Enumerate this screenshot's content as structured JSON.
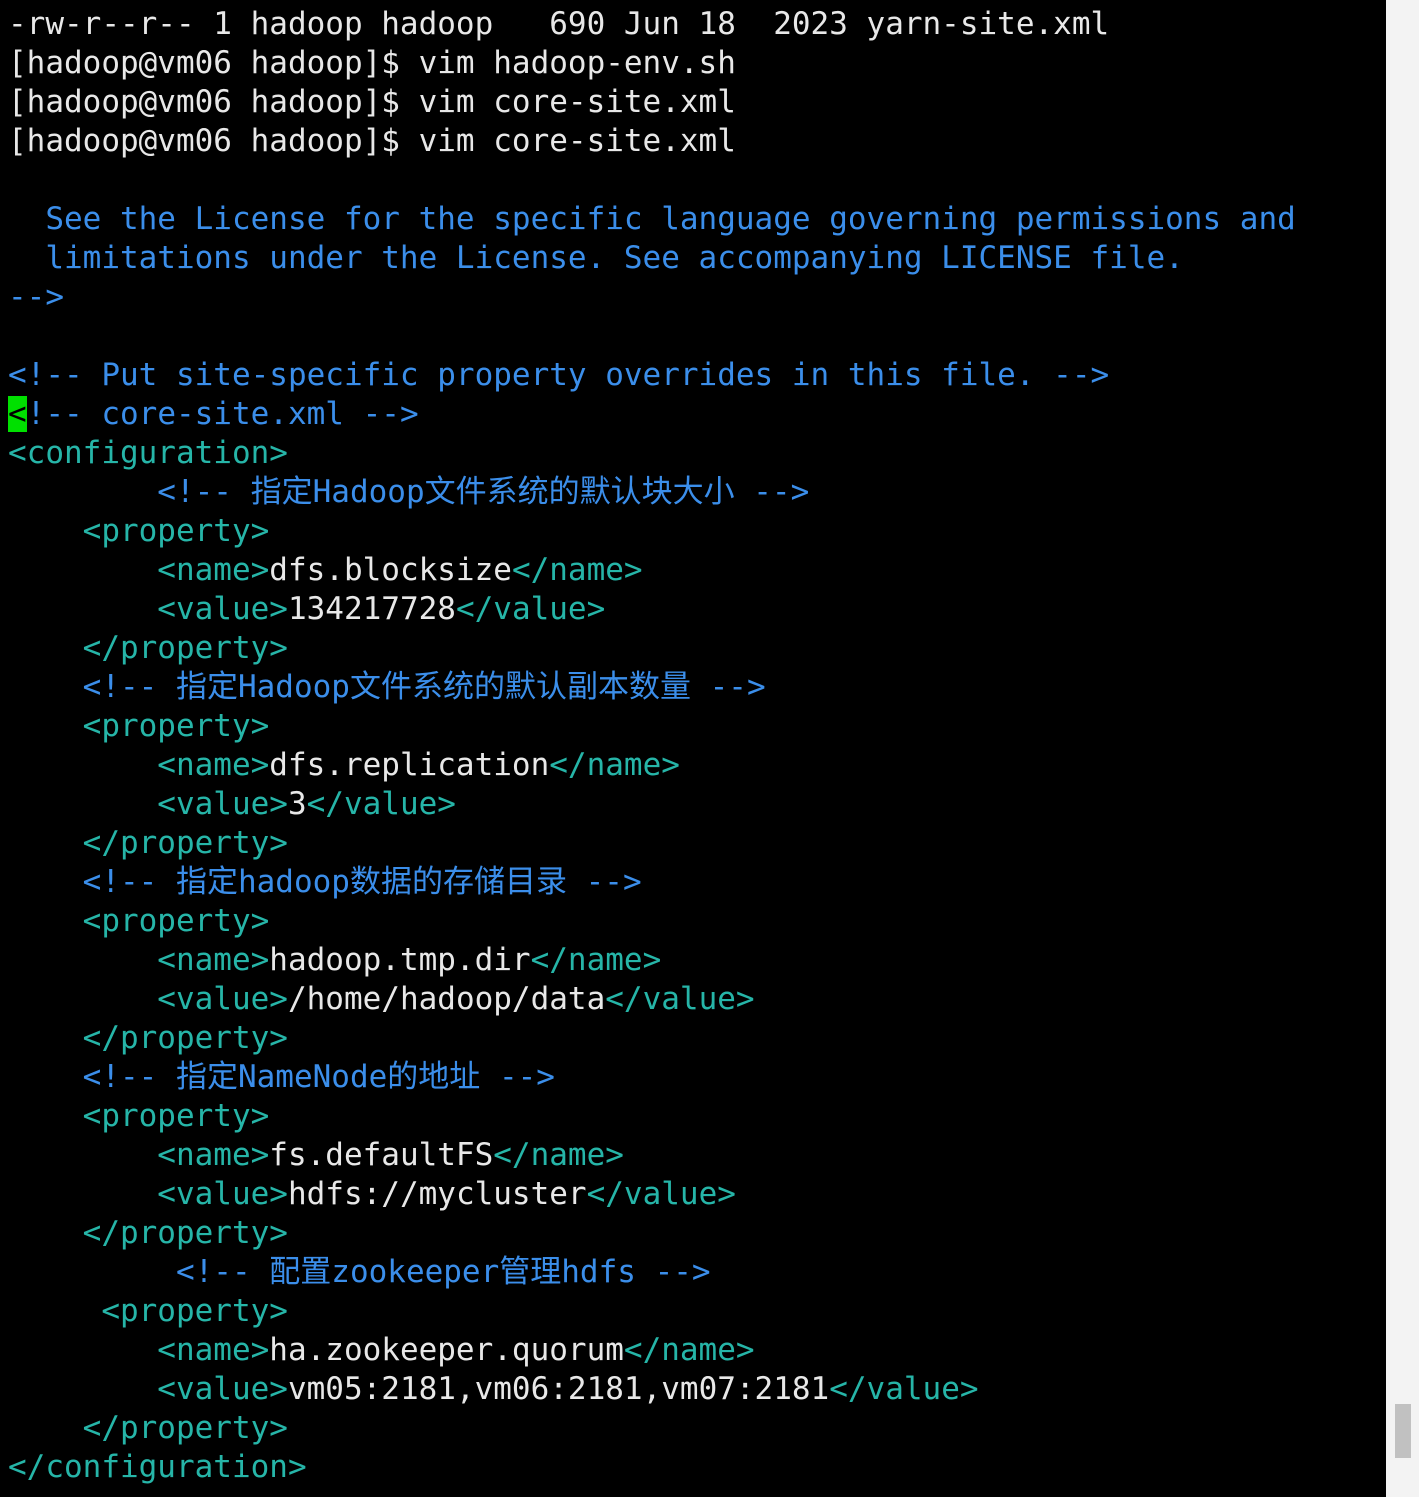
{
  "terminal": {
    "lines": [
      {
        "segments": [
          {
            "type": "t",
            "text": "-rw-r--r-- 1 hadoop hadoop   690 Jun 18  2023 yarn-site.xml"
          }
        ]
      },
      {
        "segments": [
          {
            "type": "t",
            "text": "[hadoop@vm06 hadoop]$ vim hadoop-env.sh"
          }
        ]
      },
      {
        "segments": [
          {
            "type": "t",
            "text": "[hadoop@vm06 hadoop]$ vim core-site.xml"
          }
        ]
      },
      {
        "segments": [
          {
            "type": "t",
            "text": "[hadoop@vm06 hadoop]$ vim core-site.xml"
          }
        ]
      },
      {
        "segments": []
      },
      {
        "segments": [
          {
            "type": "c",
            "text": "  See the License for the specific language governing permissions and"
          }
        ]
      },
      {
        "segments": [
          {
            "type": "c",
            "text": "  limitations under the License. See accompanying LICENSE file."
          }
        ]
      },
      {
        "segments": [
          {
            "type": "c",
            "text": "-->"
          }
        ]
      },
      {
        "segments": []
      },
      {
        "segments": [
          {
            "type": "c",
            "text": "<!-- Put site-specific property overrides in this file. -->"
          }
        ]
      },
      {
        "segments": [
          {
            "type": "cursor",
            "text": "<"
          },
          {
            "type": "c",
            "text": "!-- core-site.xml -->"
          }
        ]
      },
      {
        "segments": [
          {
            "type": "g",
            "text": "<configuration>"
          }
        ]
      },
      {
        "segments": [
          {
            "type": "c",
            "text": "        <!-- 指定Hadoop文件系统的默认块大小 -->"
          }
        ]
      },
      {
        "segments": [
          {
            "type": "g",
            "text": "    <property>"
          }
        ]
      },
      {
        "segments": [
          {
            "type": "g",
            "text": "        <name>"
          },
          {
            "type": "t",
            "text": "dfs.blocksize"
          },
          {
            "type": "g",
            "text": "</name>"
          }
        ]
      },
      {
        "segments": [
          {
            "type": "g",
            "text": "        <value>"
          },
          {
            "type": "t",
            "text": "134217728"
          },
          {
            "type": "g",
            "text": "</value>"
          }
        ]
      },
      {
        "segments": [
          {
            "type": "g",
            "text": "    </property>"
          }
        ]
      },
      {
        "segments": [
          {
            "type": "c",
            "text": "    <!-- 指定Hadoop文件系统的默认副本数量 -->"
          }
        ]
      },
      {
        "segments": [
          {
            "type": "g",
            "text": "    <property>"
          }
        ]
      },
      {
        "segments": [
          {
            "type": "g",
            "text": "        <name>"
          },
          {
            "type": "t",
            "text": "dfs.replication"
          },
          {
            "type": "g",
            "text": "</name>"
          }
        ]
      },
      {
        "segments": [
          {
            "type": "g",
            "text": "        <value>"
          },
          {
            "type": "t",
            "text": "3"
          },
          {
            "type": "g",
            "text": "</value>"
          }
        ]
      },
      {
        "segments": [
          {
            "type": "g",
            "text": "    </property>"
          }
        ]
      },
      {
        "segments": [
          {
            "type": "c",
            "text": "    <!-- 指定hadoop数据的存储目录 -->"
          }
        ]
      },
      {
        "segments": [
          {
            "type": "g",
            "text": "    <property>"
          }
        ]
      },
      {
        "segments": [
          {
            "type": "g",
            "text": "        <name>"
          },
          {
            "type": "t",
            "text": "hadoop.tmp.dir"
          },
          {
            "type": "g",
            "text": "</name>"
          }
        ]
      },
      {
        "segments": [
          {
            "type": "g",
            "text": "        <value>"
          },
          {
            "type": "t",
            "text": "/home/hadoop/data"
          },
          {
            "type": "g",
            "text": "</value>"
          }
        ]
      },
      {
        "segments": [
          {
            "type": "g",
            "text": "    </property>"
          }
        ]
      },
      {
        "segments": [
          {
            "type": "c",
            "text": "    <!-- 指定NameNode的地址 -->"
          }
        ]
      },
      {
        "segments": [
          {
            "type": "g",
            "text": "    <property>"
          }
        ]
      },
      {
        "segments": [
          {
            "type": "g",
            "text": "        <name>"
          },
          {
            "type": "t",
            "text": "fs.defaultFS"
          },
          {
            "type": "g",
            "text": "</name>"
          }
        ]
      },
      {
        "segments": [
          {
            "type": "g",
            "text": "        <value>"
          },
          {
            "type": "t",
            "text": "hdfs://mycluster"
          },
          {
            "type": "g",
            "text": "</value>"
          }
        ]
      },
      {
        "segments": [
          {
            "type": "g",
            "text": "    </property>"
          }
        ]
      },
      {
        "segments": [
          {
            "type": "c",
            "text": "         <!-- 配置zookeeper管理hdfs -->"
          }
        ]
      },
      {
        "segments": [
          {
            "type": "g",
            "text": "     <property>"
          }
        ]
      },
      {
        "segments": [
          {
            "type": "g",
            "text": "        <name>"
          },
          {
            "type": "t",
            "text": "ha.zookeeper.quorum"
          },
          {
            "type": "g",
            "text": "</name>"
          }
        ]
      },
      {
        "segments": [
          {
            "type": "g",
            "text": "        <value>"
          },
          {
            "type": "t",
            "text": "vm05:2181,vm06:2181,vm07:2181"
          },
          {
            "type": "g",
            "text": "</value>"
          }
        ]
      },
      {
        "segments": [
          {
            "type": "g",
            "text": "    </property>"
          }
        ]
      },
      {
        "segments": [
          {
            "type": "g",
            "text": "</configuration>"
          }
        ]
      }
    ]
  },
  "scrollbar": {
    "position_fraction": 0.96
  },
  "colors": {
    "background": "#000000",
    "text": "#e8e8e8",
    "comment": "#3b8eea",
    "tag": "#26b5a8",
    "cursor": "#00e000"
  }
}
